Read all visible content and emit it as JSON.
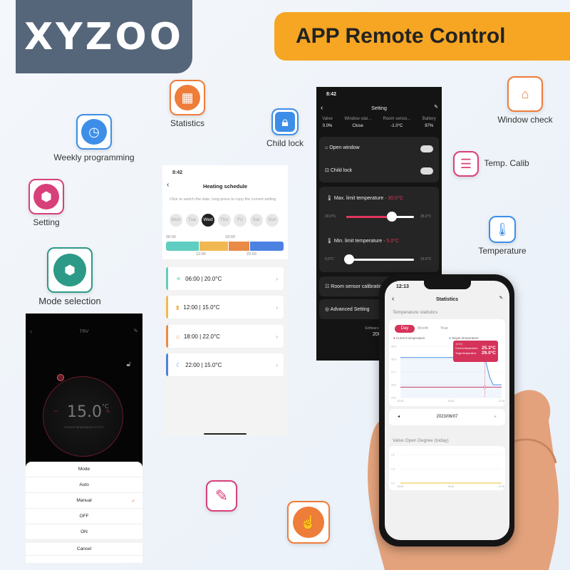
{
  "brand": {
    "logo": "XYZOO",
    "banner": "APP Remote Control"
  },
  "features": [
    {
      "label": "Statistics",
      "icon": "calendar-icon",
      "color": "#ee7d3a"
    },
    {
      "label": "Weekly programming",
      "icon": "clock-icon",
      "color": "#3d8ee8"
    },
    {
      "label": "Child lock",
      "icon": "lock-icon",
      "color": "#3d8ee8"
    },
    {
      "label": "Setting",
      "icon": "gear-icon",
      "color": "#d8407a"
    },
    {
      "label": "Mode selection",
      "icon": "nut-icon",
      "color": "#2c9a86"
    },
    {
      "label": "Window check",
      "icon": "house-search-icon",
      "color": "#ee7d3a"
    },
    {
      "label": "Temp.  Calib",
      "icon": "sliders-icon",
      "color": "#d8407a"
    },
    {
      "label": "Temperature",
      "icon": "thermometer-icon",
      "color": "#3d8ee8"
    },
    {
      "label": "",
      "icon": "edit-icon",
      "color": "#d8407a"
    },
    {
      "label": "",
      "icon": "touch-icon",
      "color": "#ee7d3a"
    }
  ],
  "schedule": {
    "time": "8:42",
    "title": "Heating schedule",
    "hint": "Click to switch the date, long press to copy the current setting",
    "days": [
      "Mon",
      "Tue",
      "Wed",
      "Thu",
      "Fri",
      "Sat",
      "Sun"
    ],
    "selected_day": "Wed",
    "timeline_top": [
      "06:00",
      "18:00"
    ],
    "timeline_bottom": [
      "12:00",
      "22:00"
    ],
    "segment_colors": [
      "#5fcdbf",
      "#f1b852",
      "#e98a47",
      "#4c82e2"
    ],
    "items": [
      {
        "text": "06:00  |  20.0°C",
        "icon": "sun-icon",
        "color": "#5fcdbf"
      },
      {
        "text": "12:00  |  15.0°C",
        "icon": "door-icon",
        "color": "#f1b852"
      },
      {
        "text": "18:00  |  22.0°C",
        "icon": "home-icon",
        "color": "#e98a47"
      },
      {
        "text": "22:00  |  15.0°C",
        "icon": "moon-icon",
        "color": "#4c82e2"
      }
    ]
  },
  "setting": {
    "time": "8:42",
    "title": "Setting",
    "stats": [
      {
        "label": "Valve",
        "value": "0.0%"
      },
      {
        "label": "Window stat...",
        "value": "Close"
      },
      {
        "label": "Room senso...",
        "value": "-1.0°C"
      },
      {
        "label": "Battery",
        "value": "97%"
      }
    ],
    "open_window": "Open window",
    "child_lock": "Child lock",
    "max_label": "Max. limit temperature",
    "max_value": "30.0°C",
    "max_min": "20.0°C",
    "max_max": "35.0°C",
    "max_fraction": 0.67,
    "min_label": "Min. limit temperature",
    "min_value": "5.0°C",
    "min_min": "5.0°C",
    "min_max": "15.0°C",
    "min_fraction": 0,
    "room_calib": "Room sensor calibratior",
    "advanced": "Advanced Setting",
    "software": "Software",
    "software_value": "200"
  },
  "trv": {
    "title": "TRV",
    "setpoint": "15.0",
    "unit": "°C",
    "current": "Current temperature 27.9°C",
    "minus": "−",
    "plus": "+",
    "sheet_title": "Mode",
    "modes": [
      "Auto",
      "Manual",
      "OFF",
      "ON"
    ],
    "selected": "Manual",
    "cancel": "Cancel"
  },
  "stats": {
    "time": "12:13",
    "title": "Statistics",
    "section": "Temperature statistics",
    "tabs": [
      "Day",
      "Month",
      "Year"
    ],
    "active_tab": "Day",
    "date": "2023/06/07",
    "valve_section": "Valve Open Degree (today)",
    "tooltip": {
      "time": "10:00",
      "current_label": "Current temperature",
      "current": "25.3°C",
      "target_label": "Target temperature",
      "target": "29.0°C"
    }
  },
  "chart_data": [
    {
      "type": "line",
      "x_ticks": [
        "00:00",
        "06:00",
        "12:00"
      ],
      "y_ticks": [
        "24.0",
        "25.6",
        "27.2",
        "28.8",
        "30.4"
      ],
      "ylim": [
        24.0,
        30.4
      ],
      "xlim": [
        0,
        12
      ],
      "series": [
        {
          "name": "Current temperature",
          "color": "#d5335a",
          "x": [
            0,
            10,
            12
          ],
          "y": [
            25.3,
            25.3,
            25.3
          ]
        },
        {
          "name": "Target temperature",
          "color": "#4a90e2",
          "x": [
            0,
            10,
            10.6,
            11,
            12
          ],
          "y": [
            29.0,
            29.0,
            26.5,
            25.6,
            25.6
          ]
        }
      ]
    },
    {
      "type": "line",
      "x_ticks": [
        "00:00",
        "06:00",
        "12:00"
      ],
      "y_ticks": [
        "0.0",
        "1.0",
        "2.0"
      ],
      "ylim": [
        0,
        2
      ],
      "xlim": [
        0,
        12
      ],
      "series": [
        {
          "color": "#f2c230",
          "x": [
            0,
            12
          ],
          "y": [
            0,
            0
          ]
        }
      ]
    }
  ]
}
